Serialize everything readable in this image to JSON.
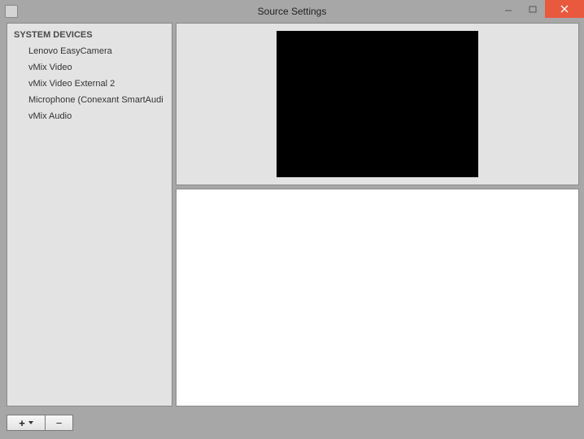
{
  "window": {
    "title": "Source Settings"
  },
  "sidebar": {
    "section_header": "SYSTEM DEVICES",
    "devices": [
      {
        "label": "Lenovo EasyCamera"
      },
      {
        "label": "vMix Video"
      },
      {
        "label": "vMix Video External 2"
      },
      {
        "label": "Microphone (Conexant SmartAudi"
      },
      {
        "label": "vMix Audio"
      }
    ]
  },
  "footer": {
    "add_label": "+",
    "remove_label": "−"
  }
}
